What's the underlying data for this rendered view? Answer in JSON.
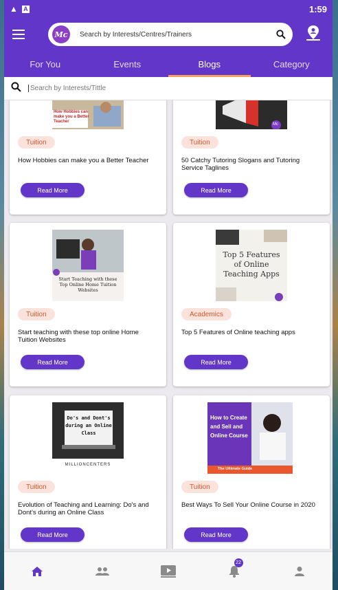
{
  "status_bar": {
    "time": "1:59"
  },
  "app_bar": {
    "logo_text": "Mc",
    "search_placeholder": "Search by Interests/Centres/Trainers"
  },
  "tabs": [
    {
      "label": "For You"
    },
    {
      "label": "Events"
    },
    {
      "label": "Blogs",
      "active": true
    },
    {
      "label": "Category"
    }
  ],
  "blog_search": {
    "placeholder": "Search by Interests/Tittle"
  },
  "read_more_label": "Read More",
  "cards": [
    {
      "badge": "Tuition",
      "title": "How Hobbies can make you a Better Teacher",
      "thumb_text": "How Hobbies can make you a Better Teacher"
    },
    {
      "badge": "Tuition",
      "title": "50 Catchy Tutoring Slogans and Tutoring Service Taglines",
      "thumb_text": "Mc"
    },
    {
      "badge": "Tuition",
      "title": "Start teaching with these top online Home Tuition Websites",
      "thumb_text": "Start Teaching with these Top Online Home Tuition Websites"
    },
    {
      "badge": "Academics",
      "title": "Top 5 Features of Online teaching apps",
      "thumb_text": "Top 5 Features of Online Teaching Apps"
    },
    {
      "badge": "Tuition",
      "title": "Evolution of Teaching and Learning: Do's and Dont's during an Online Class",
      "thumb_text": "Do's and Dont's during an Online Class",
      "thumb_brand": "MILLIONCENTERS"
    },
    {
      "badge": "Tuition",
      "title": "Best Ways To Sell Your Online Course in 2020",
      "thumb_text": "How to Create and Sell and Online Course",
      "thumb_sub": "The Ultimate Guide"
    }
  ],
  "bottom_nav": {
    "notification_count": "22",
    "items": [
      "home-icon",
      "people-icon",
      "video-icon",
      "bell-icon",
      "person-icon"
    ]
  },
  "colors": {
    "primary": "#6236c9",
    "accent": "#f5a25c",
    "badge_bg": "#fbe3dc",
    "badge_text": "#d2572e"
  }
}
